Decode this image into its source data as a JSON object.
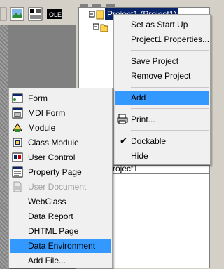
{
  "project_explorer": {
    "root_label": "Project1 (Project1)",
    "properties_value": "roject1"
  },
  "context_menu": {
    "items": [
      {
        "label": "Set as Start Up"
      },
      {
        "label": "Project1 Properties..."
      },
      {
        "label": "Save Project"
      },
      {
        "label": "Remove Project"
      },
      {
        "label": "Add",
        "highlighted": true
      },
      {
        "label": "Print..."
      },
      {
        "label": "Dockable",
        "checked": true
      },
      {
        "label": "Hide"
      }
    ]
  },
  "add_submenu": {
    "items": [
      {
        "label": "Form",
        "icon": "form-icon"
      },
      {
        "label": "MDI Form",
        "icon": "mdi-form-icon"
      },
      {
        "label": "Module",
        "icon": "module-icon"
      },
      {
        "label": "Class Module",
        "icon": "class-module-icon"
      },
      {
        "label": "User Control",
        "icon": "user-control-icon"
      },
      {
        "label": "Property Page",
        "icon": "property-page-icon"
      },
      {
        "label": "User Document",
        "icon": "user-document-icon",
        "disabled": true
      },
      {
        "label": "WebClass"
      },
      {
        "label": "Data Report"
      },
      {
        "label": "DHTML Page"
      },
      {
        "label": "Data Environment",
        "highlighted": true
      },
      {
        "label": "Add File..."
      }
    ]
  },
  "colors": {
    "highlight": "#3399ff",
    "selection": "#0a246a",
    "menu_bg": "#f0f0f0"
  }
}
